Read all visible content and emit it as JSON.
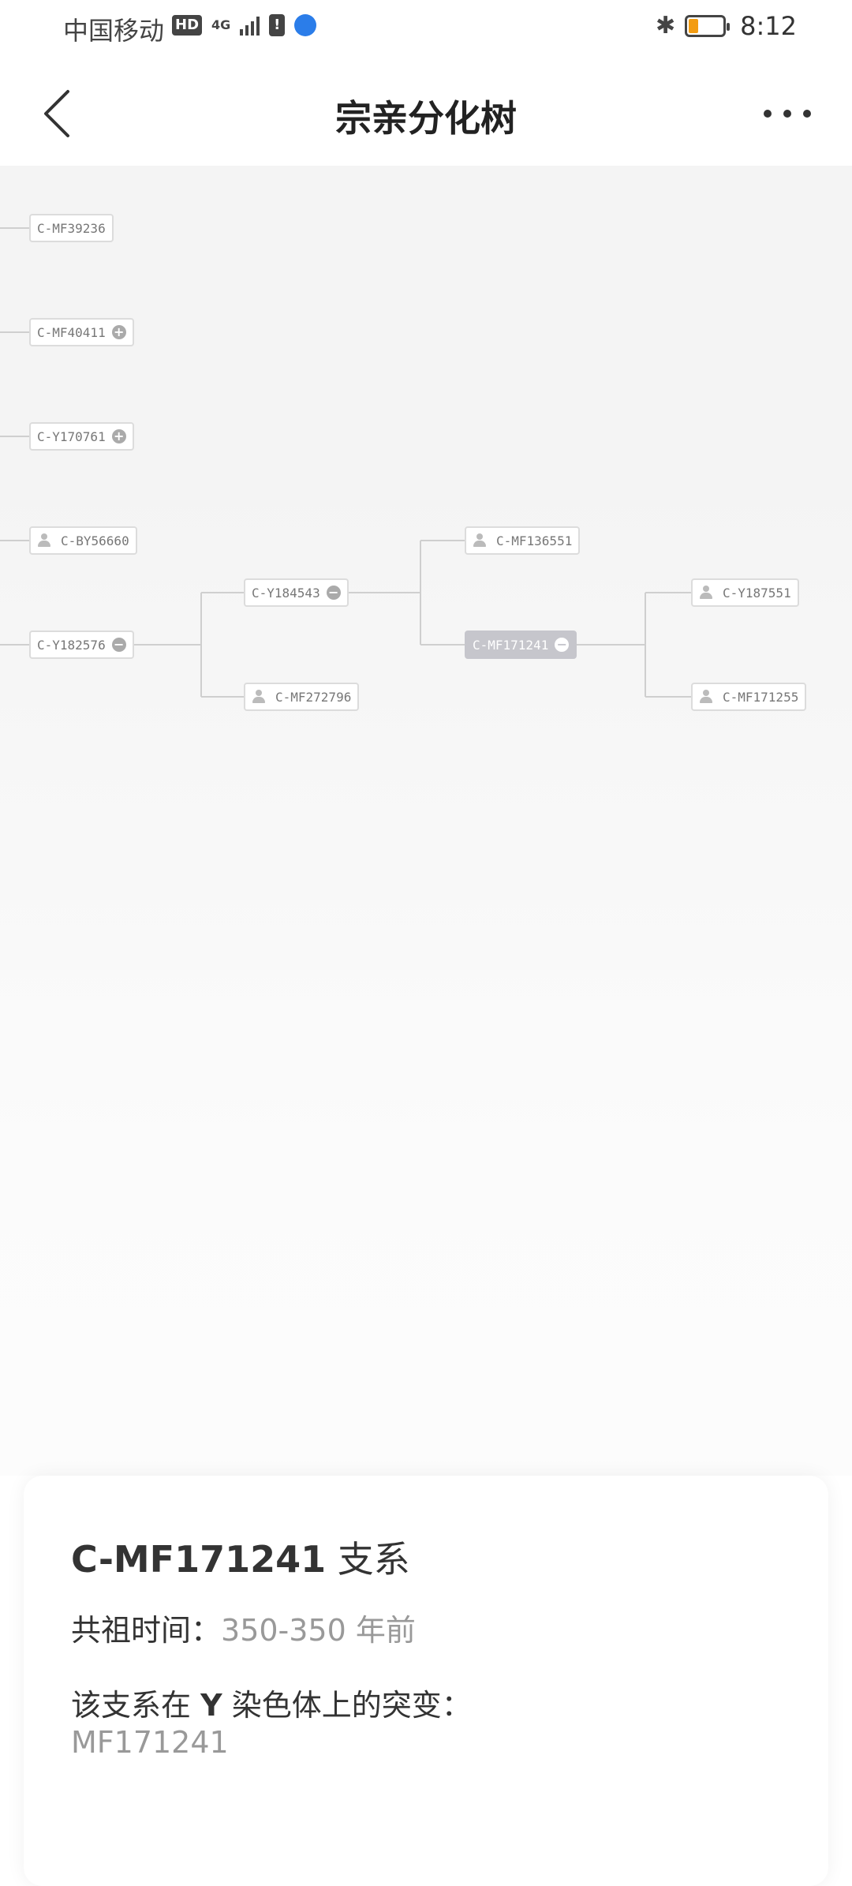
{
  "status_bar": {
    "carrier": "中国移动",
    "hd": "HD",
    "network": "4G",
    "alert": "!",
    "time": "8:12"
  },
  "nav": {
    "title": "宗亲分化树"
  },
  "tree": {
    "nodes": {
      "mf39236": "C-MF39236",
      "mf40411": "C-MF40411",
      "y170761": "C-Y170761",
      "by56660": "C-BY56660",
      "y182576": "C-Y182576",
      "y184543": "C-Y184543",
      "mf272796": "C-MF272796",
      "mf136551": "C-MF136551",
      "mf171241": "C-MF171241",
      "y187551": "C-Y187551",
      "mf171255": "C-MF171255"
    },
    "selected": "C-MF171241"
  },
  "card": {
    "title_code": "C-MF171241",
    "title_suffix": " 支系",
    "ancestor_label": "共祖时间：",
    "ancestor_value": "350-350 年前",
    "mutation_label_pre": "该支系在 ",
    "mutation_label_y": "Y",
    "mutation_label_post": " 染色体上的突变：",
    "mutation_value": "MF171241"
  },
  "colors": {
    "tree_background": "#f4f4f4",
    "node_border": "#dcdcdc",
    "selected_node": "#c6c6cc",
    "battery_level": "#f39c12",
    "globe": "#2b7de9"
  }
}
